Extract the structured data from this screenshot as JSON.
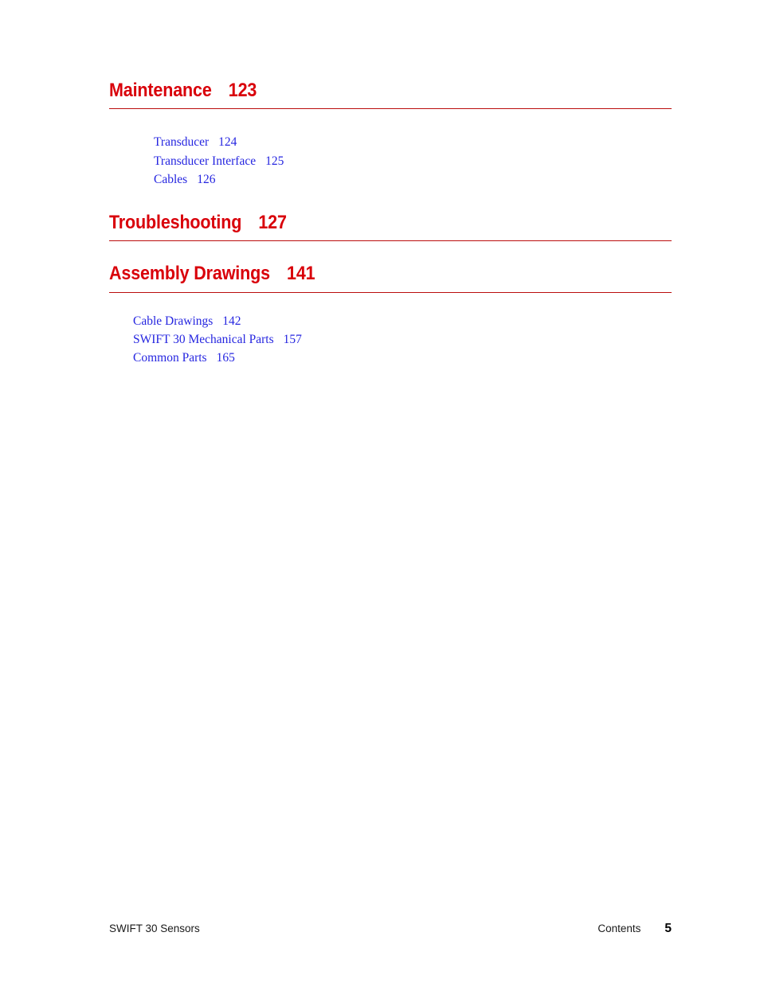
{
  "document": {
    "footer_left": "SWIFT 30 Sensors",
    "footer_section": "Contents",
    "footer_page_number": "5"
  },
  "colors": {
    "heading_red": "#d9000a",
    "rule_red": "#bb0d0d",
    "entry_blue": "#2626e0",
    "footer_text": "#1a1a1a",
    "page_background": "#ffffff"
  },
  "toc": {
    "chapters": [
      {
        "title": "Maintenance",
        "page": "123",
        "entries": [
          {
            "label": "Transducer",
            "page": "124"
          },
          {
            "label": "Transducer Interface",
            "page": "125"
          },
          {
            "label": "Cables",
            "page": "126"
          }
        ]
      },
      {
        "title": "Troubleshooting",
        "page": "127",
        "entries": []
      },
      {
        "title": "Assembly Drawings",
        "page": "141",
        "entries": [
          {
            "label": "Cable Drawings",
            "page": "142"
          },
          {
            "label": "SWIFT 30 Mechanical Parts",
            "page": "157"
          },
          {
            "label": "Common Parts",
            "page": "165"
          }
        ]
      }
    ]
  }
}
